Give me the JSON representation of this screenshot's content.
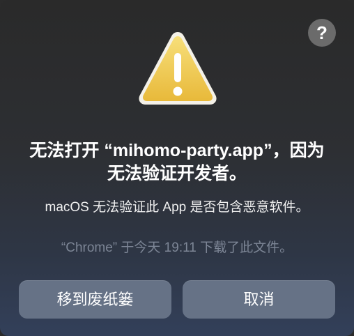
{
  "dialog": {
    "help_label": "?",
    "icon": "warning-triangle-icon",
    "title": "无法打开 “mihomo-party.app”，因为无法验证开发者。",
    "message": "macOS 无法验证此 App 是否包含恶意软件。",
    "info": "“Chrome” 于今天 19:11 下载了此文件。",
    "buttons": {
      "move_to_trash": "移到废纸篓",
      "cancel": "取消"
    },
    "colors": {
      "warning_yellow": "#F2C94C",
      "button_bg": "#667286"
    }
  }
}
